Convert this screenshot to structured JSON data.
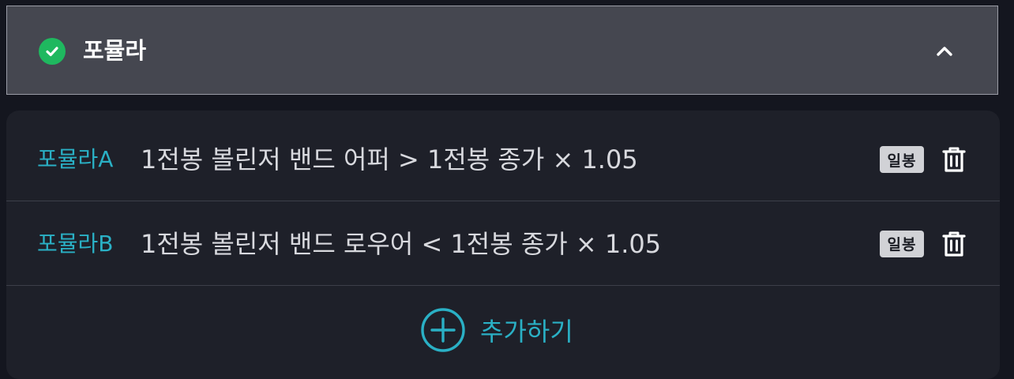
{
  "header": {
    "title": "포뮬라",
    "status_icon": "check-circle-icon",
    "toggle_icon": "chevron-up-icon",
    "accent": "#1fb85f"
  },
  "formulas": [
    {
      "name": "포뮬라A",
      "expression": "1전봉 볼린저 밴드 어퍼 > 1전봉 종가 × 1.05",
      "badge": "일봉"
    },
    {
      "name": "포뮬라B",
      "expression": "1전봉 볼린저 밴드 로우어 < 1전봉 종가 × 1.05",
      "badge": "일봉"
    }
  ],
  "add": {
    "label": "추가하기",
    "icon": "plus-circle-icon"
  },
  "colors": {
    "accent_teal": "#2ab0c5",
    "background": "#14161f",
    "card": "#1e2029",
    "header": "#454750"
  }
}
